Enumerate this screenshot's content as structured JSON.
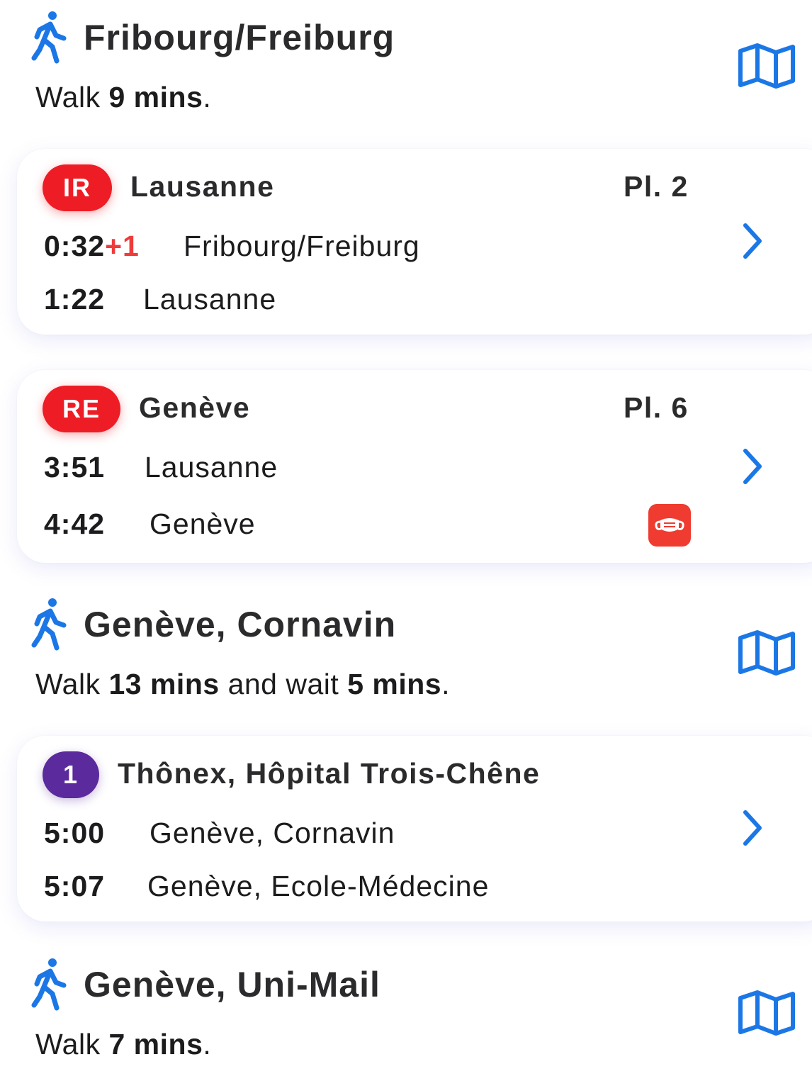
{
  "colors": {
    "accent_blue": "#1c77e6",
    "train_red": "#ee1c25",
    "tram_purple": "#5b2a9c",
    "delay_red": "#ee3b3b",
    "mask_red": "#ef3b30"
  },
  "walks": [
    {
      "icon": "walking-person-icon",
      "destination": "Fribourg/Freiburg",
      "desc_prefix": "Walk ",
      "desc_walk": "9 mins",
      "desc_suffix": ".",
      "map_icon": "map-icon"
    },
    {
      "icon": "walking-person-icon",
      "destination": "Genève, Cornavin",
      "desc_prefix": "Walk ",
      "desc_walk": "13 mins",
      "desc_middle": " and wait ",
      "desc_wait": "5 mins",
      "desc_suffix": ".",
      "map_icon": "map-icon"
    },
    {
      "icon": "walking-person-icon",
      "destination": "Genève, Uni-Mail",
      "desc_prefix": "Walk ",
      "desc_walk": "7 mins",
      "desc_suffix": ".",
      "map_icon": "map-icon"
    }
  ],
  "legs": [
    {
      "line": "IR",
      "direction": "Lausanne",
      "platform": "Pl. 2",
      "departure": {
        "time": "0:32",
        "delay": "+1",
        "stop": "Fribourg/Freiburg"
      },
      "arrival": {
        "time": "1:22",
        "stop": "Lausanne"
      }
    },
    {
      "line": "RE",
      "direction": "Genève",
      "platform": "Pl. 6",
      "departure": {
        "time": "3:51",
        "stop": "Lausanne"
      },
      "arrival": {
        "time": "4:42",
        "stop": "Genève"
      },
      "notice_icon": "face-mask-icon"
    },
    {
      "line": "1",
      "direction": "Thônex, Hôpital Trois-Chêne",
      "departure": {
        "time": "5:00",
        "stop": "Genève, Cornavin"
      },
      "arrival": {
        "time": "5:07",
        "stop": "Genève, Ecole-Médecine"
      }
    }
  ]
}
